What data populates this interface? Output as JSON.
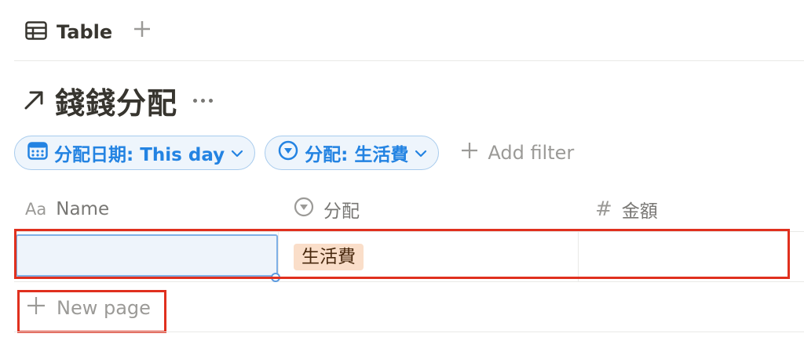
{
  "view_tabs": {
    "active_tab": {
      "icon": "table-icon",
      "label": "Table"
    },
    "add_icon": "plus-icon"
  },
  "database": {
    "title": "錢錢分配",
    "link_icon": "link-arrow-icon",
    "more_icon": "more-horizontal-icon"
  },
  "filters": [
    {
      "icon": "calendar-icon",
      "label": "分配日期: This day",
      "chevron": "chevron-down-icon"
    },
    {
      "icon": "select-icon",
      "label": "分配: 生活費",
      "chevron": "chevron-down-icon"
    }
  ],
  "add_filter": {
    "icon": "plus-icon",
    "label": "Add filter"
  },
  "columns": [
    {
      "icon": "Aa",
      "icon_name": "text-property-icon",
      "label": "Name"
    },
    {
      "icon": "select-icon",
      "label": "分配"
    },
    {
      "icon": "#",
      "icon_name": "number-property-icon",
      "label": "金額"
    }
  ],
  "rows": [
    {
      "name": "",
      "allocation": "生活費",
      "amount": ""
    }
  ],
  "new_page": {
    "icon": "plus-icon",
    "label": "New page"
  },
  "colors": {
    "accent": "#2383e2",
    "chip_bg": "#eef5fc",
    "chip_border": "#a7cbed",
    "tag_bg": "#fadec9",
    "tag_text": "#49290e",
    "annotation_red": "#e0301e",
    "muted_text": "#9b9a97"
  }
}
